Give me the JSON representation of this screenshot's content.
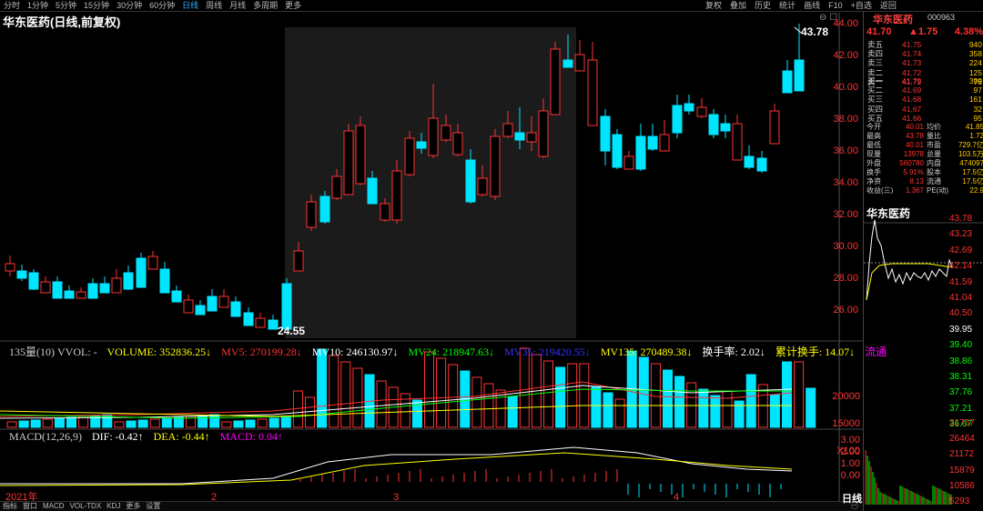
{
  "toolbar": {
    "tabs": [
      "分时",
      "1分钟",
      "5分钟",
      "15分钟",
      "30分钟",
      "60分钟",
      "日线",
      "周线",
      "月线",
      "多周期",
      "更多"
    ],
    "active_tab": "日线",
    "tools": [
      "复权",
      "叠加",
      "历史",
      "统计",
      "画线",
      "F10",
      "+自选",
      "返回"
    ]
  },
  "chart_title": "华东医药(日线,前复权)",
  "lock_icons": "⊖ ☐",
  "price_axis": [
    "44.00",
    "42.00",
    "40.00",
    "38.00",
    "36.00",
    "34.00",
    "32.00",
    "30.00",
    "28.00",
    "26.00"
  ],
  "high_label": "43.78",
  "low_label": "24.55",
  "vol_indicator": {
    "name": "135量(10) VVOL: -",
    "volume": "VOLUME: 352836.25↓",
    "mv5": "MV5: 270199.28↓",
    "mv10": "MV10: 246130.97↓",
    "mv24": "MV24: 218947.63↓",
    "mv35": "MV35: 219420.55↓",
    "mv135": "MV135: 270489.38↓",
    "turnover": "换手率: 2.02↓",
    "cum_turnover": "累计换手: 14.07↓",
    "flow": "流通"
  },
  "vol_axis": [
    "20000",
    "15000",
    "X100"
  ],
  "macd_indicator": {
    "name": "MACD(12,26,9)",
    "dif": "DIF: -0.42↑",
    "dea": "DEA: -0.44↑",
    "macd": "MACD: 0.04↑"
  },
  "macd_axis": [
    "3.00",
    "2.00",
    "1.00",
    "0.00"
  ],
  "date_labels": [
    "2021年",
    "2",
    "3",
    "4"
  ],
  "bottom_tabs": [
    "指标",
    "窗口",
    "MACD",
    "VOL-TDX",
    "KDJ",
    "更多",
    "设置"
  ],
  "bottom_right": "㊀",
  "rp": {
    "name": "华东医药",
    "code": "000963",
    "price": "41.70",
    "change": "▲1.75",
    "pct": "4.38%",
    "asks": [
      [
        "卖五",
        "41.75",
        "940"
      ],
      [
        "卖四",
        "41.74",
        "358"
      ],
      [
        "卖三",
        "41.73",
        "224"
      ],
      [
        "卖二",
        "41.72",
        "125"
      ],
      [
        "卖一",
        "41.71",
        "76"
      ]
    ],
    "bids": [
      [
        "买一",
        "41.70",
        "399"
      ],
      [
        "买二",
        "41.69",
        "97"
      ],
      [
        "买三",
        "41.68",
        "161"
      ],
      [
        "买四",
        "41.67",
        "32"
      ],
      [
        "买五",
        "41.66",
        "95"
      ]
    ],
    "stats": [
      [
        "今开",
        "40.01",
        "均价",
        "41.85"
      ],
      [
        "最高",
        "43.78",
        "量比",
        "1.72"
      ],
      [
        "最低",
        "40.01",
        "市盈",
        "729.7亿"
      ],
      [
        "现量",
        "13978",
        "总量",
        "103.5万"
      ],
      [
        "外盘",
        "560780",
        "内盘",
        "474097"
      ],
      [
        "换手",
        "5.91%",
        "股本",
        "17.5亿"
      ],
      [
        "净资",
        "8.13",
        "流通",
        "17.5亿"
      ],
      [
        "收益(三)",
        "1.367",
        "PE(动)",
        "22.9"
      ]
    ],
    "mini_title": "华东医药",
    "mini_axis_right": [
      "43.78",
      "43.23",
      "42.69",
      "42.14",
      "41.59",
      "41.04",
      "40.50",
      "39.95",
      "39.40",
      "38.86",
      "38.31",
      "37.76",
      "37.21",
      "36.67"
    ],
    "mini_vol_axis": [
      "31757",
      "26464",
      "21172",
      "15879",
      "10586",
      "5293"
    ]
  },
  "day_label": "日线",
  "colors": {
    "up": "#ff3333",
    "down": "#00ffff",
    "bg": "#000000",
    "yellow": "#ffff00",
    "green": "#00ff00",
    "blue": "#0000ff",
    "magenta": "#ff00ff"
  }
}
